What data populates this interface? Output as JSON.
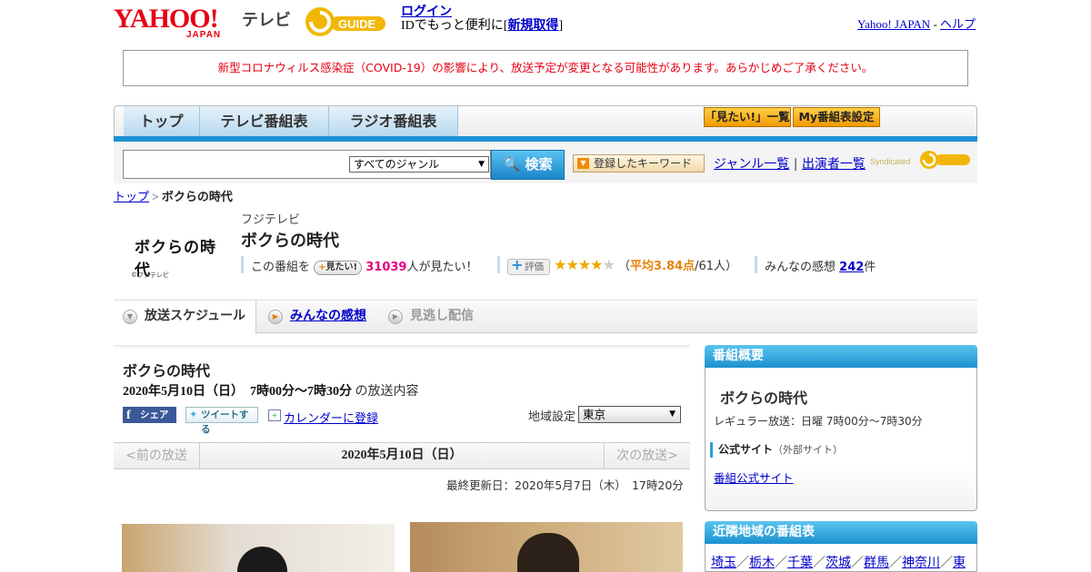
{
  "header": {
    "yahoo_logo": "YAHOO!",
    "yahoo_japan": "JAPAN",
    "tv_label": "テレビ",
    "gguide_logo": "GUIDE",
    "login_link": "ログイン",
    "id_text": "IDでもっと便利に[",
    "signup_link": "新規取得",
    "id_close": "]",
    "yahoo_japan_link": "Yahoo! JAPAN",
    "dash": "-",
    "help_link": "ヘルプ"
  },
  "notice": "新型コロナウィルス感染症（COVID-19）の影響により、放送予定が変更となる可能性があります。あらかじめご了承ください。",
  "nav": {
    "tabs": [
      "トップ",
      "テレビ番組表",
      "ラジオ番組表"
    ],
    "mitai_list": "「見たい!」一覧",
    "my_settings": "My番組表設定"
  },
  "search": {
    "input_value": "",
    "genre_selected": "すべてのジャンル",
    "button": "検索",
    "keyword_button": "登録したキーワード",
    "genre_list_link": "ジャンル一覧",
    "divider": "|",
    "performers_link": "出演者一覧",
    "syndicated": "Syndicated"
  },
  "breadcrumb": {
    "top": "トップ",
    "sep": ">",
    "current": "ボクらの時代"
  },
  "program": {
    "logo_text": "ボクらの時代",
    "logo_copyright": "©フジテレビ",
    "station": "フジテレビ",
    "title": "ボクらの時代",
    "mitai_prefix": "この番組を",
    "mitai_button": "見たい!",
    "mitai_count": "31039",
    "mitai_suffix": "人が見たい！",
    "rating_button": "評価",
    "rating_stars": 3.84,
    "rating_open": "（",
    "rating_avg": "平均3.84点",
    "rating_people": "/61人）",
    "reviews_prefix": "みんなの感想",
    "reviews_count": "242",
    "reviews_suffix": "件"
  },
  "subtabs": [
    "放送スケジュール",
    "みんなの感想",
    "見逃し配信"
  ],
  "episode": {
    "title": "ボクらの時代",
    "date": "2020年5月10日（日）　7時00分～7時30分",
    "date_suffix": "の放送内容",
    "share_facebook": "シェア",
    "share_twitter": "ツイートする",
    "calendar_link": "カレンダーに登録",
    "region_label": "地域設定",
    "region_selected": "東京"
  },
  "pager": {
    "prev": "<前の放送",
    "current": "2020年5月10日（日）",
    "next": "次の放送>"
  },
  "updated": "最終更新日：2020年5月7日（木）　17時20分",
  "sidebar": {
    "overview_title": "番組概要",
    "program_title": "ボクらの時代",
    "regular": "レギュラー放送：日曜 7時00分～7時30分",
    "official_heading": "公式サイト",
    "official_note": "（外部サイト）",
    "official_link": "番組公式サイト",
    "nearby_title": "近隣地域の番組表",
    "nearby_regions": [
      "埼玉",
      "栃木",
      "千葉",
      "茨城",
      "群馬",
      "神奈川",
      "東"
    ]
  },
  "colors": {
    "yahoo_red": "#e60012",
    "accent_blue": "#1e8fd4",
    "pink": "#e4007f",
    "orange": "#e8820c"
  }
}
